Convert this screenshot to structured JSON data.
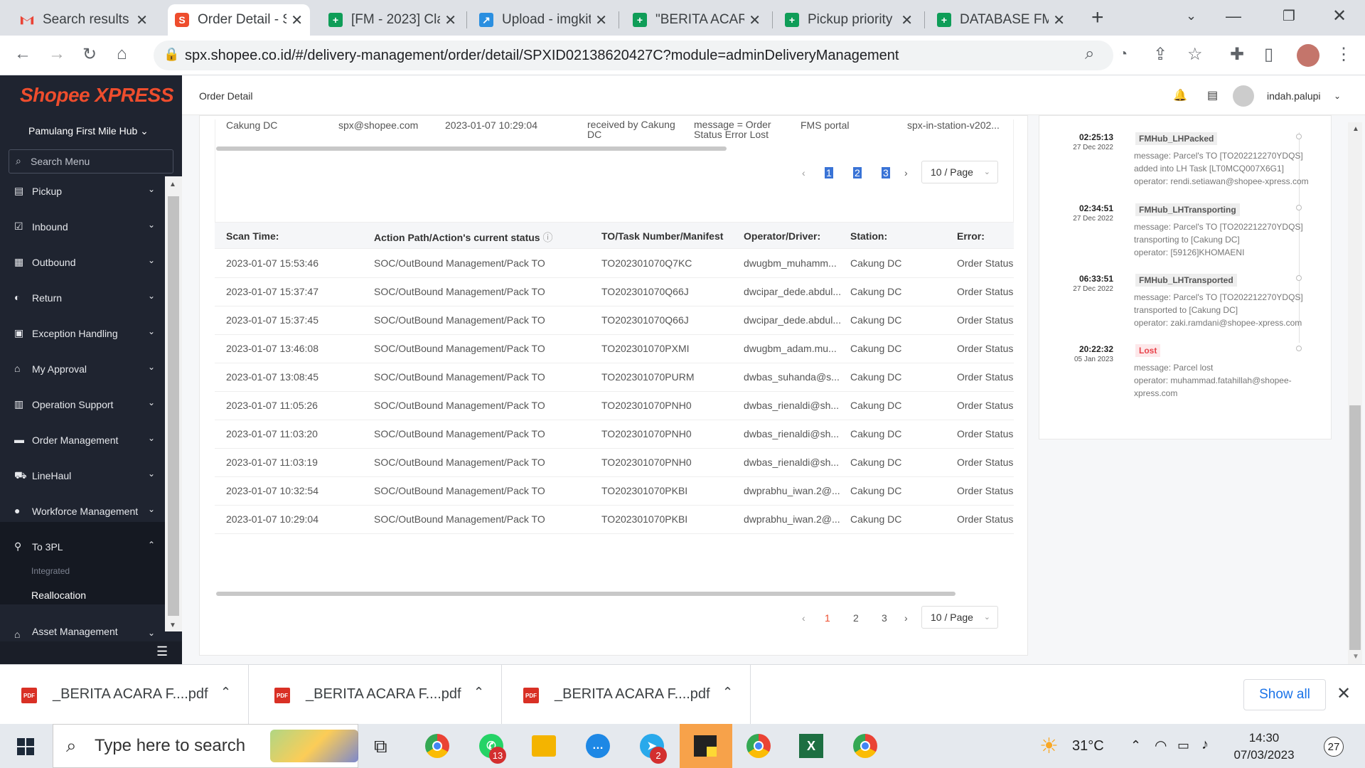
{
  "browser": {
    "tabs": [
      {
        "title": "Search results -",
        "icon": "gmail-icon",
        "left": 0
      },
      {
        "title": "Order Detail - S",
        "icon": "shopee-icon",
        "active": true
      },
      {
        "title": "[FM - 2023] Cla",
        "icon": "sheets-icon"
      },
      {
        "title": "Upload - imgkit",
        "icon": "upload-icon"
      },
      {
        "title": "\"BERITA ACARA",
        "icon": "sheets-icon"
      },
      {
        "title": "Pickup priority",
        "icon": "sheets-icon"
      },
      {
        "title": "DATABASE FM",
        "icon": "sheets-icon"
      }
    ],
    "url": "spx.shopee.co.id/#/delivery-management/order/detail/SPXID02138620427C?module=adminDeliveryManagement"
  },
  "sidebar": {
    "logo": "Shopee XPRESS",
    "hub": "Pamulang First Mile Hub",
    "search_placeholder": "Search Menu",
    "items": [
      {
        "label": "Pickup"
      },
      {
        "label": "Inbound"
      },
      {
        "label": "Outbound"
      },
      {
        "label": "Return"
      },
      {
        "label": "Exception Handling"
      },
      {
        "label": "My Approval"
      },
      {
        "label": "Operation Support"
      },
      {
        "label": "Order Management"
      },
      {
        "label": "LineHaul"
      },
      {
        "label": "Workforce Management"
      },
      {
        "label": "To 3PL"
      },
      {
        "label": "Asset Management"
      }
    ],
    "sub_integrated": "Integrated",
    "sub_reallocation": "Reallocation"
  },
  "header": {
    "breadcrumb": "Order Detail",
    "username": "indah.palupi"
  },
  "table1": {
    "row": [
      "Cakung DC",
      "spx@shopee.com",
      "2023-01-07 10:29:04",
      "received by Cakung DC",
      "message = Order Status Error Lost",
      "FMS portal",
      "spx-in-station-v202..."
    ],
    "pages": [
      "1",
      "2",
      "3"
    ],
    "page_size": "10 / Page"
  },
  "table2": {
    "headers": [
      "Scan Time:",
      "Action Path/Action's current status",
      "TO/Task Number/Manifest",
      "Operator/Driver:",
      "Station:",
      "Error:"
    ],
    "rows": [
      [
        "2023-01-07 15:53:46",
        "SOC/OutBound Management/Pack TO",
        "TO202301070Q7KC",
        "dwugbm_muhamm...",
        "Cakung DC",
        "Order Status"
      ],
      [
        "2023-01-07 15:37:47",
        "SOC/OutBound Management/Pack TO",
        "TO202301070Q66J",
        "dwcipar_dede.abdul...",
        "Cakung DC",
        "Order Status"
      ],
      [
        "2023-01-07 15:37:45",
        "SOC/OutBound Management/Pack TO",
        "TO202301070Q66J",
        "dwcipar_dede.abdul...",
        "Cakung DC",
        "Order Status"
      ],
      [
        "2023-01-07 13:46:08",
        "SOC/OutBound Management/Pack TO",
        "TO202301070PXMI",
        "dwugbm_adam.mu...",
        "Cakung DC",
        "Order Status"
      ],
      [
        "2023-01-07 13:08:45",
        "SOC/OutBound Management/Pack TO",
        "TO202301070PURM",
        "dwbas_suhanda@s...",
        "Cakung DC",
        "Order Status"
      ],
      [
        "2023-01-07 11:05:26",
        "SOC/OutBound Management/Pack TO",
        "TO202301070PNH0",
        "dwbas_rienaldi@sh...",
        "Cakung DC",
        "Order Status"
      ],
      [
        "2023-01-07 11:03:20",
        "SOC/OutBound Management/Pack TO",
        "TO202301070PNH0",
        "dwbas_rienaldi@sh...",
        "Cakung DC",
        "Order Status"
      ],
      [
        "2023-01-07 11:03:19",
        "SOC/OutBound Management/Pack TO",
        "TO202301070PNH0",
        "dwbas_rienaldi@sh...",
        "Cakung DC",
        "Order Status"
      ],
      [
        "2023-01-07 10:32:54",
        "SOC/OutBound Management/Pack TO",
        "TO202301070PKBI",
        "dwprabhu_iwan.2@...",
        "Cakung DC",
        "Order Status"
      ],
      [
        "2023-01-07 10:29:04",
        "SOC/OutBound Management/Pack TO",
        "TO202301070PKBI",
        "dwprabhu_iwan.2@...",
        "Cakung DC",
        "Order Status"
      ]
    ],
    "pages": [
      "1",
      "2",
      "3"
    ],
    "page_size": "10 / Page"
  },
  "timeline": [
    {
      "time": "02:25:13",
      "date": "27 Dec 2022",
      "tag": "FMHub_LHPacked",
      "msg": [
        "message: Parcel's TO [TO202212270YDQS]",
        "added into LH Task [LT0MCQ007X6G1]",
        "operator: rendi.setiawan@shopee-xpress.com"
      ]
    },
    {
      "time": "02:34:51",
      "date": "27 Dec 2022",
      "tag": "FMHub_LHTransporting",
      "msg": [
        "message: Parcel's TO [TO202212270YDQS]",
        "transporting to [Cakung DC]",
        "operator: [59126]KHOMAENI"
      ]
    },
    {
      "time": "06:33:51",
      "date": "27 Dec 2022",
      "tag": "FMHub_LHTransported",
      "msg": [
        "message: Parcel's TO [TO202212270YDQS]",
        "transported to [Cakung DC]",
        "operator: zaki.ramdani@shopee-xpress.com"
      ]
    },
    {
      "time": "20:22:32",
      "date": "05 Jan 2023",
      "tag": "Lost",
      "msg": [
        "message: Parcel lost",
        "operator: muhammad.fatahillah@shopee-",
        "xpress.com"
      ]
    }
  ],
  "downloads": {
    "files": [
      "_BERITA ACARA F....pdf",
      "_BERITA ACARA F....pdf",
      "_BERITA ACARA F....pdf"
    ],
    "show_all": "Show all"
  },
  "taskbar": {
    "search_placeholder": "Type here to search",
    "whatsapp_badge": "13",
    "telegram_badge": "2",
    "temperature": "31°C",
    "time": "14:30",
    "date": "07/03/2023",
    "notifications": "27"
  }
}
